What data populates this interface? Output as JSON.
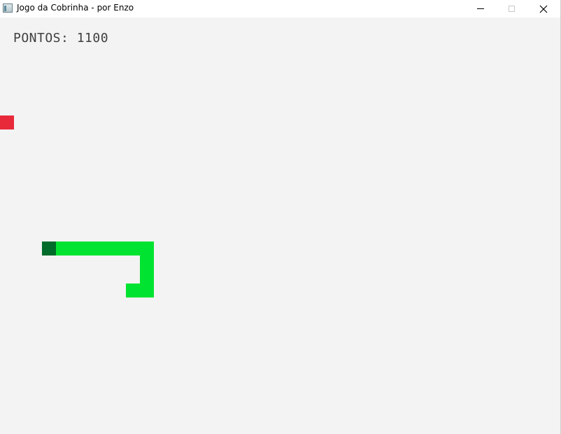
{
  "window": {
    "title": "Jogo da Cobrinha - por Enzo",
    "app_icon": "app-window-icon",
    "controls": {
      "minimize_icon": "minimize-icon",
      "maximize_icon": "maximize-icon",
      "close_icon": "close-icon"
    }
  },
  "game": {
    "score_text": "PONTOS: 1100",
    "score": 1100,
    "colors": {
      "background": "#f3f3f3",
      "snake_head": "#006b2a",
      "snake_body": "#00e330",
      "food": "#e8293a",
      "score_text": "#3f3f3f"
    }
  }
}
